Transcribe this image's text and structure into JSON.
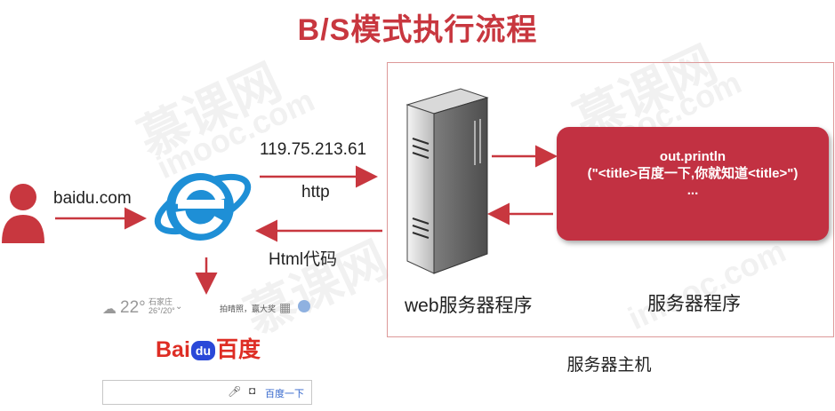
{
  "title": "B/S模式执行流程",
  "client": {
    "url": "baidu.com",
    "ip": "119.75.213.61",
    "protocol": "http",
    "response": "Html代码"
  },
  "server": {
    "web_label": "web服务器程序",
    "program_label": "服务器程序",
    "host_label": "服务器主机",
    "code_lines": [
      "out.println",
      "(\"<title>百度一下,你就知道<title>\")",
      "..."
    ]
  },
  "baidu": {
    "weather_temp": "22°",
    "weather_city": "石家庄",
    "weather_range": "26°/20°",
    "hot_text": "拍晴照，赢大奖",
    "logo_left": "Bai",
    "logo_du": "du",
    "logo_right": "百度",
    "search_button": "百度一下"
  },
  "watermark": [
    "慕课网",
    "imooc.com"
  ],
  "colors": {
    "accent": "#c8373f",
    "box": "#c23142",
    "ie_blue": "#1e8fd6"
  }
}
